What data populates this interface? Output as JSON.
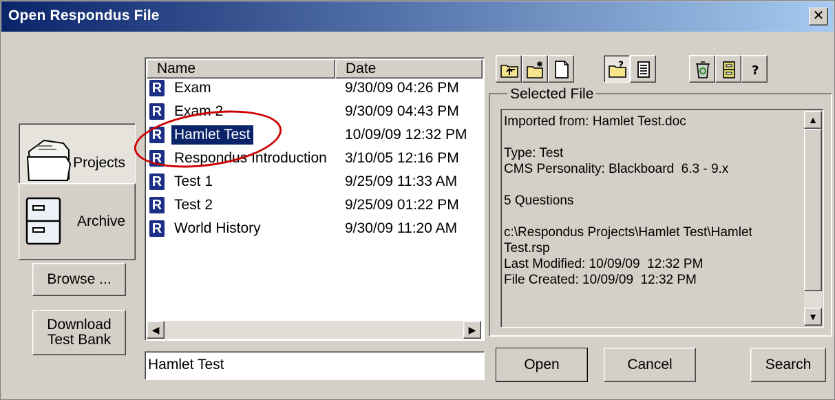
{
  "window": {
    "title": "Open Respondus File",
    "close_symbol": "✕"
  },
  "nav": {
    "projects_label": "Projects",
    "archive_label": "Archive",
    "browse_label": "Browse ...",
    "download_line1": "Download",
    "download_line2": "Test Bank"
  },
  "file_list": {
    "columns": {
      "name": "Name",
      "date": "Date"
    },
    "items": [
      {
        "name": "Exam",
        "date": "9/30/09  04:26 PM"
      },
      {
        "name": "Exam 2",
        "date": "9/30/09  04:43 PM"
      },
      {
        "name": "Hamlet Test",
        "date": "10/09/09  12:32 PM"
      },
      {
        "name": "Respondus Introduction",
        "date": "3/10/05  12:16 PM"
      },
      {
        "name": "Test 1",
        "date": "9/25/09  11:33 AM"
      },
      {
        "name": "Test 2",
        "date": "9/25/09  01:22 PM"
      },
      {
        "name": "World History",
        "date": "9/30/09  11:20 AM"
      }
    ],
    "selected_index": 2,
    "file_icon_letter": "R"
  },
  "filename_field": {
    "value": "Hamlet Test"
  },
  "toolbar": {
    "icons": [
      "up-folder-icon",
      "new-folder-icon",
      "new-file-icon",
      "properties-icon",
      "details-view-icon",
      "delete-icon",
      "archive-icon",
      "help-icon"
    ]
  },
  "selected_file": {
    "legend": "Selected File",
    "details": "Imported from: Hamlet Test.doc\n\nType: Test\nCMS Personality: Blackboard  6.3 - 9.x\n\n5 Questions\n\nc:\\Respondus Projects\\Hamlet Test\\Hamlet Test.rsp\nLast Modified: 10/09/09  12:32 PM\nFile Created: 10/09/09  12:32 PM"
  },
  "buttons": {
    "open": "Open",
    "cancel": "Cancel",
    "search": "Search"
  },
  "colors": {
    "titlebar_start": "#0a246a",
    "titlebar_end": "#a6caf0",
    "dialog_bg": "#d4d0c8",
    "selection": "#0a246a",
    "highlight_circle": "#cc0000",
    "file_icon": "#1c2f86"
  }
}
